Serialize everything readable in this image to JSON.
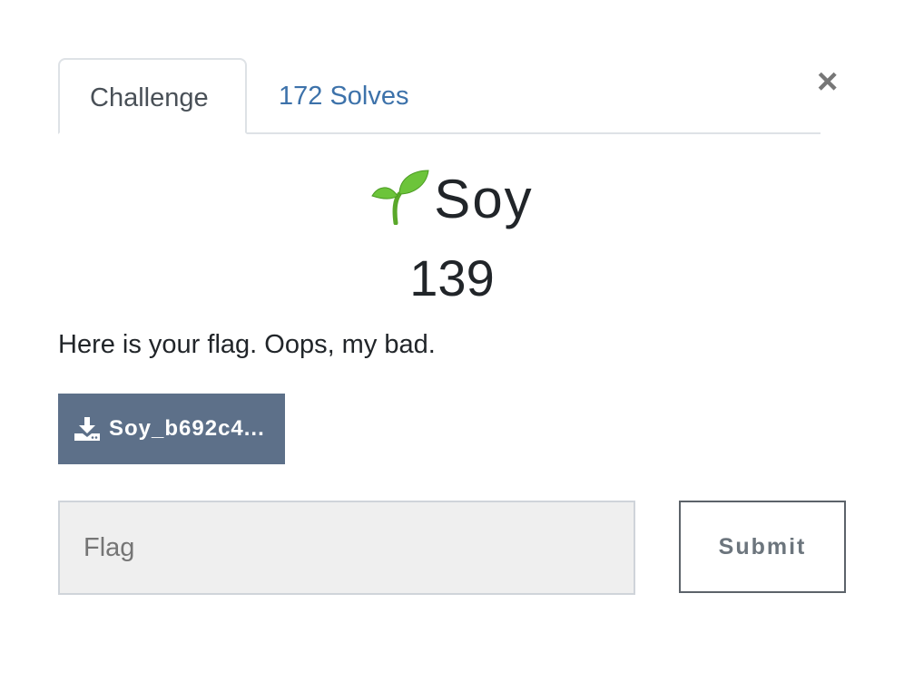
{
  "tabs": [
    {
      "label": "Challenge",
      "active": true
    },
    {
      "label": "172 Solves",
      "active": false
    }
  ],
  "close_label": "×",
  "challenge": {
    "icon": "seedling-icon",
    "name": "Soy",
    "points": "139",
    "description": "Here is your flag. Oops, my bad.",
    "file_label": "Soy_b692c4..."
  },
  "form": {
    "flag_placeholder": "Flag",
    "flag_value": "",
    "submit_label": "Submit"
  },
  "colors": {
    "link": "#3d72aa",
    "download_bg": "#5d7089"
  }
}
